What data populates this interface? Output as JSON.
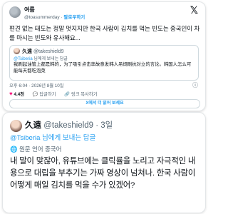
{
  "tweet": {
    "user_name": "여름",
    "user_handle": "@toasummerday",
    "separator": " · ",
    "follow_label": "팔로우하기",
    "text": "편견 없는 태도는 정말 멋지지만 한국 사람이 김치를 먹는 빈도는 중국인이 차를 마시는 빈도와 유사해요...",
    "quote": {
      "name": "久遠",
      "handle": "@takeshield9",
      "reply_prefix": "@Tsiberia",
      "reply_suffix": " 님에게 보내는 답글",
      "text": "我刷起油管上都是韩的，为了吸引点击率故意发韩人吊炯刷抗对立的言论。韩国人怎么可能每天都吃泡菜"
    },
    "timestamp": "오후 6:04 · 2026년 8월 10일",
    "likes": "4.4천",
    "reply_label": "답글하기",
    "copy_label": "링크 복사하기",
    "more_label": "X에서 더 읽어 보세요"
  },
  "post2": {
    "name": "久遠",
    "handle": "@takeshield9",
    "meta": " · 3일",
    "reply_prefix": "@Tsiberia",
    "reply_suffix": " 님에게 보내는 답글",
    "translate_label": "원문 언어 중국어",
    "text": "내 말이 맞잖아, 유튜브에는 클릭률을 노리고 자극적인 내용으로 대립을 부추기는 가짜 영상이 넘쳐나. 한국 사람이 어떻게 매일 김치를 먹을 수가 있겠어?"
  },
  "colors": {
    "accent": "#1d9bf0",
    "like": "#f91880",
    "muted": "#536471",
    "text": "#0f1419"
  },
  "icons": [
    "x-logo-icon",
    "info-icon",
    "heart-icon",
    "reply-icon",
    "link-icon",
    "globe-icon"
  ]
}
